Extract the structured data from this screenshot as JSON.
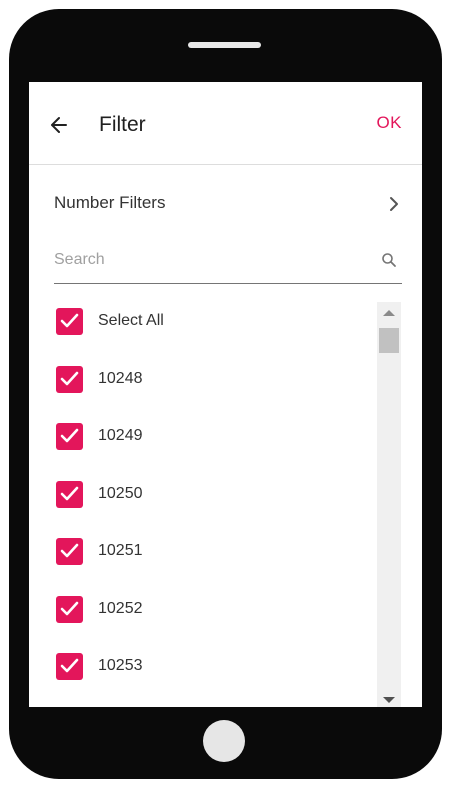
{
  "header": {
    "title": "Filter",
    "ok_label": "OK"
  },
  "number_filters": {
    "label": "Number Filters"
  },
  "search": {
    "placeholder": "Search",
    "value": ""
  },
  "list": {
    "items": [
      {
        "label": "Select All",
        "checked": true
      },
      {
        "label": "10248",
        "checked": true
      },
      {
        "label": "10249",
        "checked": true
      },
      {
        "label": "10250",
        "checked": true
      },
      {
        "label": "10251",
        "checked": true
      },
      {
        "label": "10252",
        "checked": true
      },
      {
        "label": "10253",
        "checked": true
      }
    ]
  },
  "icons": {
    "back": "arrow-left-icon",
    "chevron": "chevron-right-icon",
    "search": "search-icon",
    "check": "check-icon"
  },
  "colors": {
    "accent": "#e3165b",
    "device": "#0a0a0a"
  }
}
